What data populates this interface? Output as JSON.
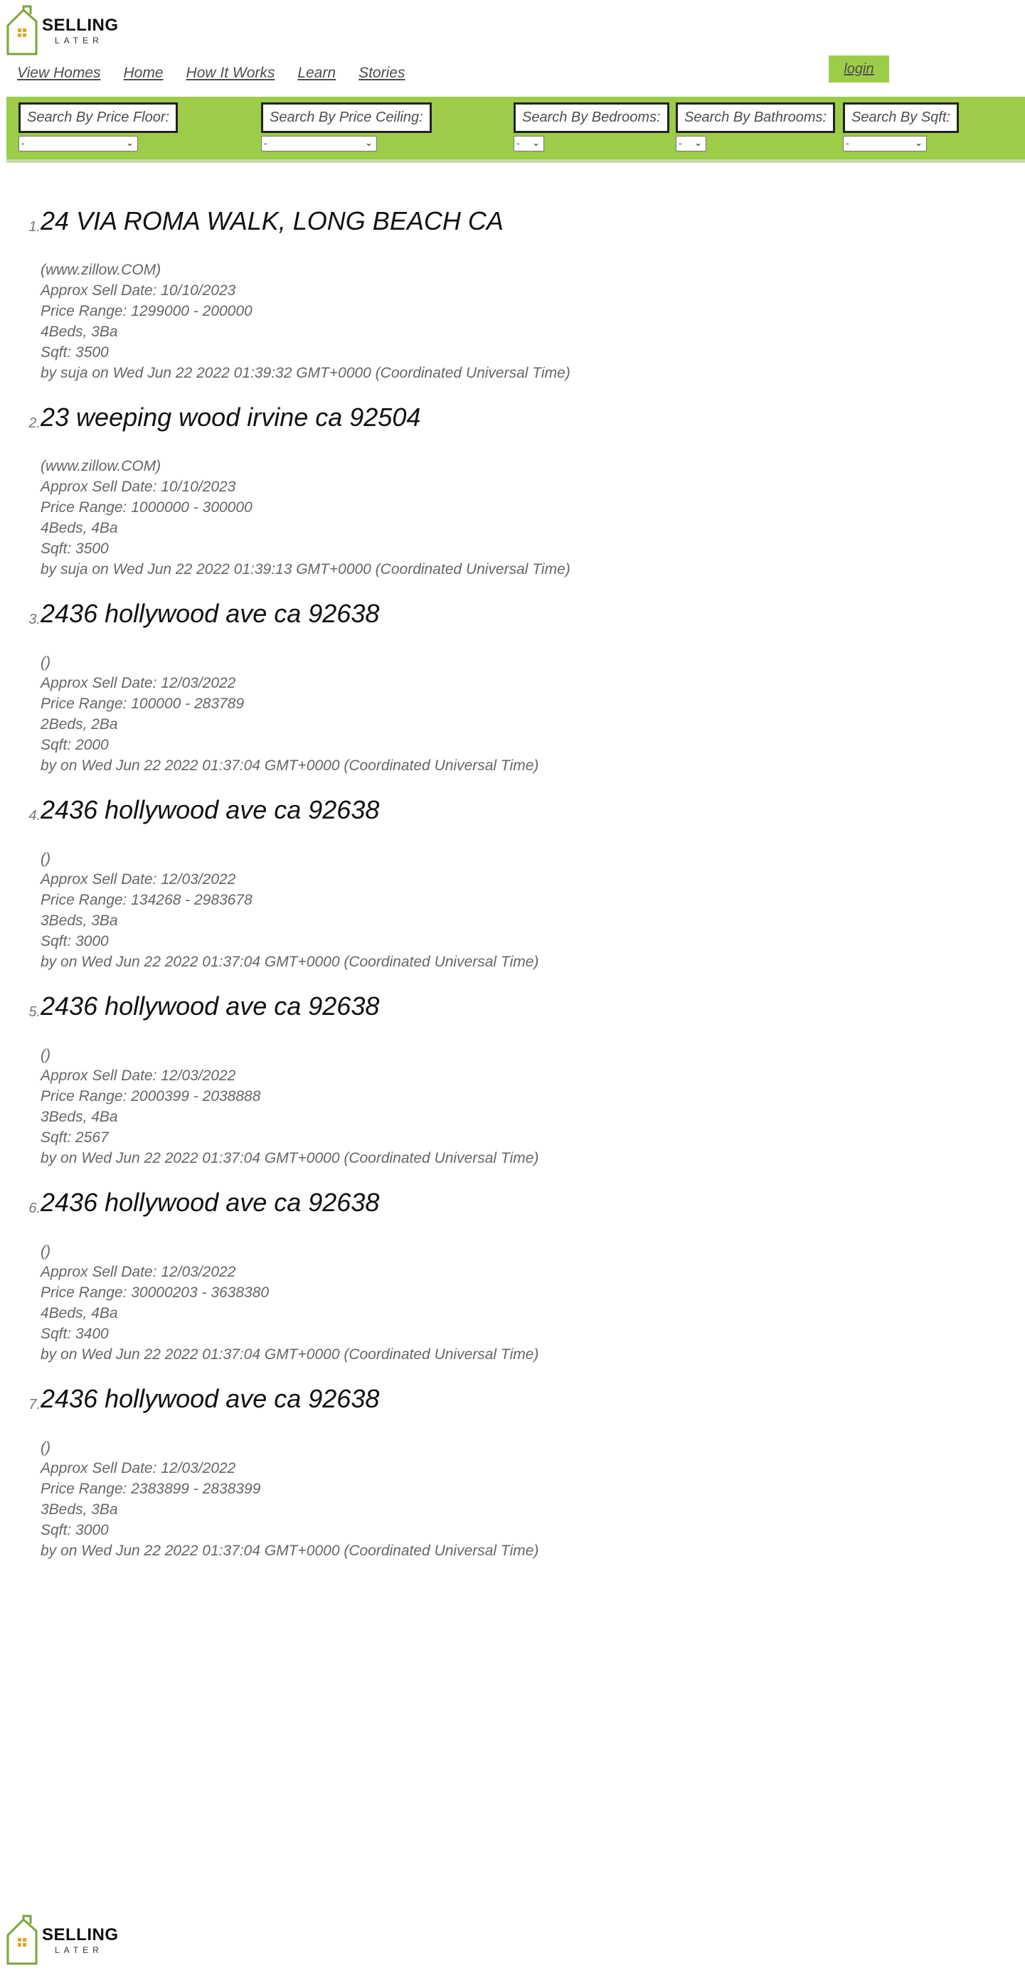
{
  "brand": {
    "name_top": "SELLING",
    "name_bottom": "LATER",
    "accent": "#9dcc49",
    "icon": "house-logo-icon"
  },
  "nav": {
    "items": [
      {
        "label": "View Homes"
      },
      {
        "label": "Home"
      },
      {
        "label": "How It Works"
      },
      {
        "label": "Learn"
      },
      {
        "label": "Stories"
      }
    ],
    "login_label": "login"
  },
  "filters": {
    "price_floor": {
      "label": "Search By Price Floor:",
      "value": "-"
    },
    "price_ceiling": {
      "label": "Search By Price Ceiling:",
      "value": "-"
    },
    "bedrooms": {
      "label": "Search By Bedrooms:",
      "value": "-"
    },
    "bathrooms": {
      "label": "Search By Bathrooms:",
      "value": "-"
    },
    "sqft": {
      "label": "Search By Sqft:",
      "value": "-"
    }
  },
  "listings": [
    {
      "number": "1.",
      "title": "24 VIA ROMA WALK, LONG BEACH CA",
      "source": "(www.zillow.COM)",
      "sell_date": "Approx Sell Date: 10/10/2023",
      "price_range": "Price Range: 1299000 - 200000",
      "beds_baths": "4Beds, 3Ba",
      "sqft": "Sqft: 3500",
      "byline": "by suja on Wed Jun 22 2022 01:39:32 GMT+0000 (Coordinated Universal Time)"
    },
    {
      "number": "2.",
      "title": "23 weeping wood irvine ca 92504",
      "source": "(www.zillow.COM)",
      "sell_date": "Approx Sell Date: 10/10/2023",
      "price_range": "Price Range: 1000000 - 300000",
      "beds_baths": "4Beds, 4Ba",
      "sqft": "Sqft: 3500",
      "byline": "by suja on Wed Jun 22 2022 01:39:13 GMT+0000 (Coordinated Universal Time)"
    },
    {
      "number": "3.",
      "title": "2436 hollywood ave ca 92638",
      "source": "()",
      "sell_date": "Approx Sell Date: 12/03/2022",
      "price_range": "Price Range: 100000 - 283789",
      "beds_baths": "2Beds, 2Ba",
      "sqft": "Sqft: 2000",
      "byline": "by on Wed Jun 22 2022 01:37:04 GMT+0000 (Coordinated Universal Time)"
    },
    {
      "number": "4.",
      "title": "2436 hollywood ave ca 92638",
      "source": "()",
      "sell_date": "Approx Sell Date: 12/03/2022",
      "price_range": "Price Range: 134268 - 2983678",
      "beds_baths": "3Beds, 3Ba",
      "sqft": "Sqft: 3000",
      "byline": "by on Wed Jun 22 2022 01:37:04 GMT+0000 (Coordinated Universal Time)"
    },
    {
      "number": "5.",
      "title": "2436 hollywood ave ca 92638",
      "source": "()",
      "sell_date": "Approx Sell Date: 12/03/2022",
      "price_range": "Price Range: 2000399 - 2038888",
      "beds_baths": "3Beds, 4Ba",
      "sqft": "Sqft: 2567",
      "byline": "by on Wed Jun 22 2022 01:37:04 GMT+0000 (Coordinated Universal Time)"
    },
    {
      "number": "6.",
      "title": "2436 hollywood ave ca 92638",
      "source": "()",
      "sell_date": "Approx Sell Date: 12/03/2022",
      "price_range": "Price Range: 30000203 - 3638380",
      "beds_baths": "4Beds, 4Ba",
      "sqft": "Sqft: 3400",
      "byline": "by on Wed Jun 22 2022 01:37:04 GMT+0000 (Coordinated Universal Time)"
    },
    {
      "number": "7.",
      "title": "2436 hollywood ave ca 92638",
      "source": "()",
      "sell_date": "Approx Sell Date: 12/03/2022",
      "price_range": "Price Range: 2383899 - 2838399",
      "beds_baths": "3Beds, 3Ba",
      "sqft": "Sqft: 3000",
      "byline": "by on Wed Jun 22 2022 01:37:04 GMT+0000 (Coordinated Universal Time)"
    }
  ]
}
